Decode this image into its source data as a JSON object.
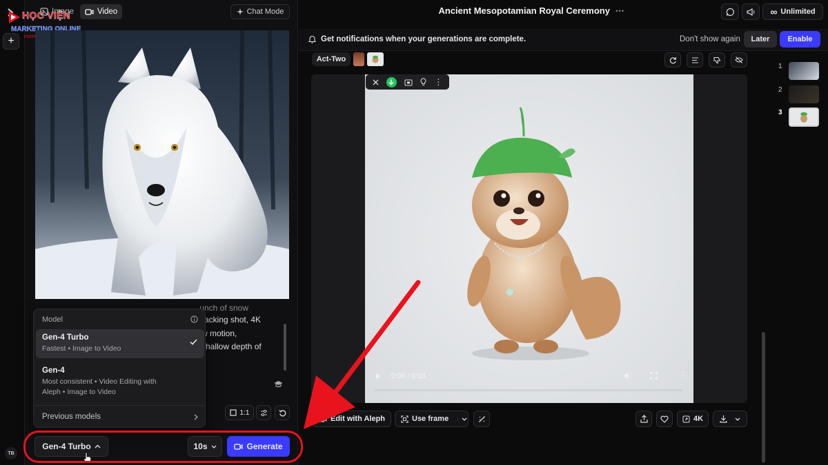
{
  "logo": {
    "line1": "HỌC VIỆN",
    "line2": "MARKETING ONLINE",
    "tagline": "Vươn Xa Cùng Bạn"
  },
  "rail": {
    "plus_label": "+",
    "avatar_initials": "TB",
    "expand_icon": "chevron-right-icon"
  },
  "left": {
    "tabs": [
      {
        "label": "Image",
        "icon": "image-icon"
      },
      {
        "label": "Video",
        "icon": "video-icon"
      }
    ],
    "chat_mode_label": "Chat Mode",
    "prompt_visible_lines": [
      "racking shot, 4K",
      "w motion,",
      "shallow depth of"
    ],
    "prompt_overlapped_top": "...unch of snow",
    "aspect_ratio": "1:1"
  },
  "model_menu": {
    "header": "Model",
    "items": [
      {
        "title": "Gen-4 Turbo",
        "subtitle": "Fastest • Image to Video",
        "selected": true
      },
      {
        "title": "Gen-4",
        "subtitle": "Most consistent • Video Editing with Aleph • Image to Video",
        "selected": false
      }
    ],
    "previous_label": "Previous models"
  },
  "bottom": {
    "model_label": "Gen-4 Turbo",
    "duration": "10s",
    "generate_label": "Generate"
  },
  "main": {
    "title": "Ancient Mesopotamian Royal Ceremony",
    "unlimited_label": "Unlimited",
    "notification": "Get notifications when your generations are complete.",
    "dont_show": "Don't show again",
    "later": "Later",
    "enable": "Enable",
    "act_two_label": "Act-Two",
    "video_time": "0:00 / 0:03",
    "video_progress_fraction": 0.0,
    "edit_with_aleph": "Edit with Aleph",
    "use_frame": "Use frame",
    "resolution_label": "4K"
  },
  "thumbnails": [
    {
      "index": "1"
    },
    {
      "index": "2"
    },
    {
      "index": "3"
    }
  ],
  "colors": {
    "accent_blue": "#3b3bff",
    "highlight_red": "#e8131d",
    "download_green": "#22c55e"
  }
}
